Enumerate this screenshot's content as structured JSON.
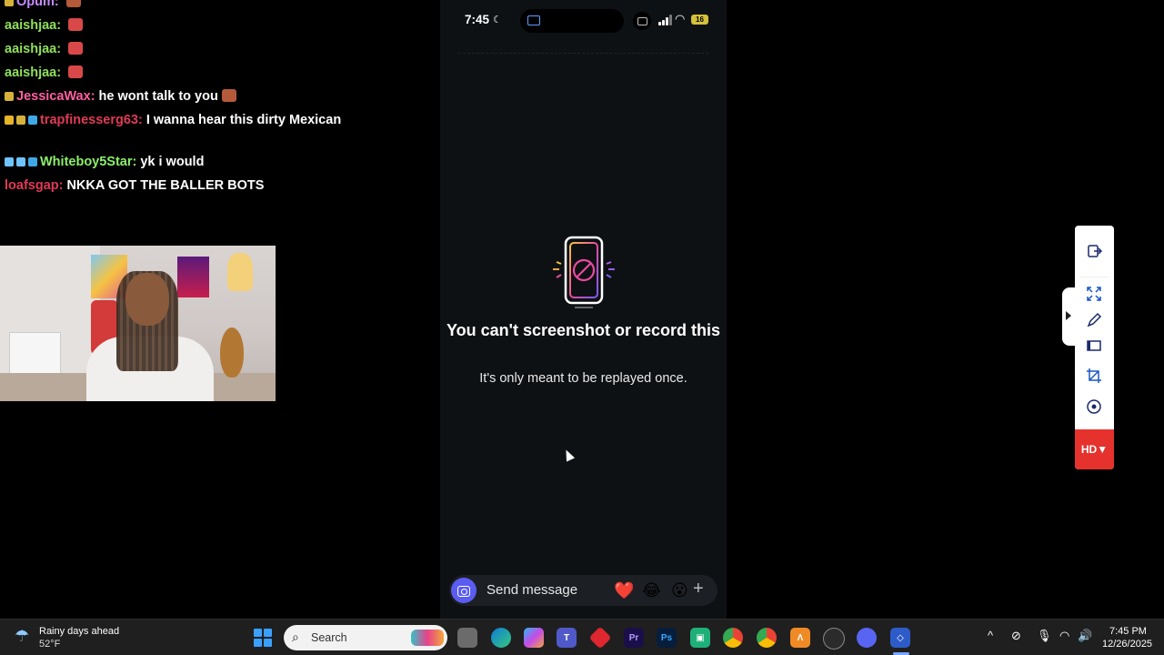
{
  "chat": {
    "messages": [
      {
        "user": "Opum:",
        "text": "",
        "user_color": "#c58bff",
        "badges": [
          "#d6b23a"
        ],
        "emote": "#b45a3a"
      },
      {
        "user": "aaishjaa:",
        "text": "",
        "user_color": "#8fe05a",
        "badges": [],
        "emote": "#d94848"
      },
      {
        "user": "aaishjaa:",
        "text": "",
        "user_color": "#8fe05a",
        "badges": [],
        "emote": "#d94848"
      },
      {
        "user": "aaishjaa:",
        "text": "",
        "user_color": "#8fe05a",
        "badges": [],
        "emote": "#d94848"
      },
      {
        "user": "JessicaWax:",
        "text": "he wont talk to you",
        "user_color": "#ff5fa0",
        "badges": [
          "#d6b23a"
        ],
        "emote": "#b45a3a"
      },
      {
        "user": "trapfinesserg63:",
        "text": "I wanna hear this dirty Mexican",
        "user_color": "#e03a56",
        "badges": [
          "#e7b42a",
          "#d6b23a",
          "#3fa9e8"
        ],
        "emote": ""
      },
      {
        "user": "Whiteboy5Star:",
        "text": "yk i would",
        "user_color": "#8cf06a",
        "badges": [
          "#6fc3ff",
          "#6fc3ff",
          "#3fa9e8"
        ],
        "emote": ""
      },
      {
        "user": "loafsgap:",
        "text": "NKKA GOT THE BALLER BOTS",
        "user_color": "#e03a56",
        "badges": [],
        "emote": ""
      }
    ]
  },
  "phone": {
    "time": "7:45",
    "battery": "16",
    "title": "You can't screenshot or record this",
    "subtitle": "It's only meant to be replayed once.",
    "composer_placeholder": "Send message",
    "reactions": [
      "❤️",
      "😂",
      "😮"
    ],
    "plus": "+"
  },
  "snip_toolbar": {
    "hd_label": "HD▼",
    "tools": [
      "exit-icon",
      "fullscreen-icon",
      "pen-icon",
      "window-icon",
      "crop-icon",
      "record-icon"
    ]
  },
  "taskbar": {
    "weather_title": "Rainy days ahead",
    "weather_temp": "52°F",
    "search_placeholder": "Search",
    "time": "7:45 PM",
    "date": "12/26/2025",
    "accent": "#3aa0ff"
  }
}
